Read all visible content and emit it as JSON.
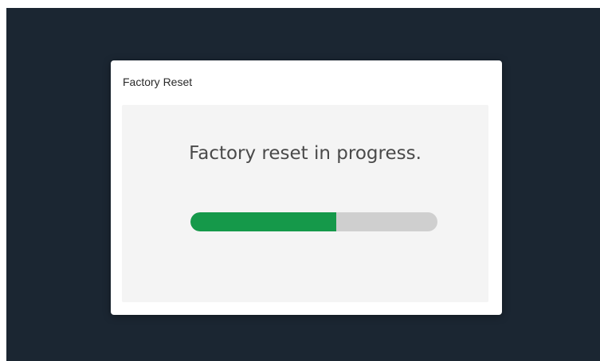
{
  "dialog": {
    "title": "Factory Reset",
    "message": "Factory reset in progress.",
    "progress": 0.59,
    "progress_color": "#15994a",
    "track_color": "#cfcfcf"
  },
  "colors": {
    "background": "#1b2632",
    "dialog": "#ffffff"
  }
}
